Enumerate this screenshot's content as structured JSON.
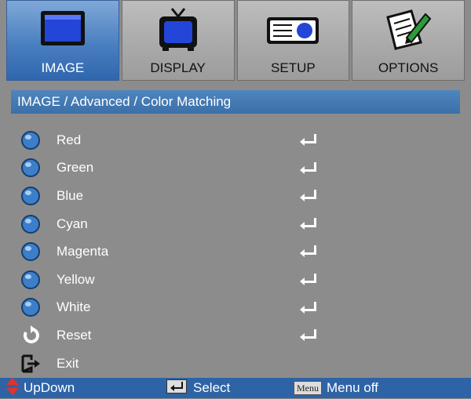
{
  "tabs": [
    {
      "label": "IMAGE",
      "icon": "monitor-icon",
      "active": true
    },
    {
      "label": "DISPLAY",
      "icon": "tv-icon",
      "active": false
    },
    {
      "label": "SETUP",
      "icon": "projector-icon",
      "active": false
    },
    {
      "label": "OPTIONS",
      "icon": "notepad-pencil-icon",
      "active": false
    }
  ],
  "breadcrumb": "IMAGE / Advanced / Color Matching",
  "items": [
    {
      "label": "Red",
      "icon": "dial-icon"
    },
    {
      "label": "Green",
      "icon": "dial-icon"
    },
    {
      "label": "Blue",
      "icon": "dial-icon"
    },
    {
      "label": "Cyan",
      "icon": "dial-icon"
    },
    {
      "label": "Magenta",
      "icon": "dial-icon"
    },
    {
      "label": "Yellow",
      "icon": "dial-icon"
    },
    {
      "label": "White",
      "icon": "dial-icon"
    },
    {
      "label": "Reset",
      "icon": "reset-icon"
    },
    {
      "label": "Exit",
      "icon": "exit-icon"
    }
  ],
  "footer": {
    "updown": "UpDown",
    "select": "Select",
    "menu_key": "Menu",
    "menu_off": "Menu off"
  },
  "colors": {
    "accent": "#2e63a6",
    "background": "#8c8c8c",
    "dial": "#3d7ec9"
  }
}
